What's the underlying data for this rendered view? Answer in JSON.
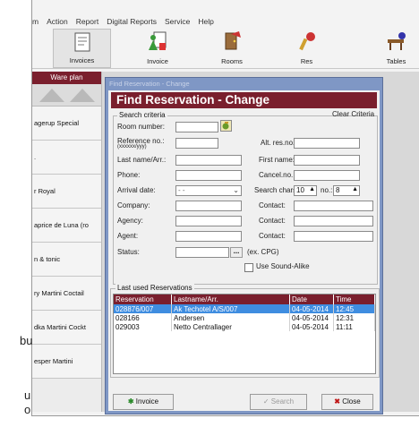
{
  "menu": [
    "m",
    "Action",
    "Report",
    "Digital Reports",
    "Service",
    "Help"
  ],
  "toolbar": {
    "invoices": "Invoices",
    "invoice": "Invoice",
    "rooms": "Rooms",
    "res": "Res",
    "tables": "Tables"
  },
  "left_panel": {
    "header": "Ware plan",
    "items": [
      "agerup Special",
      ".",
      "r Royal",
      "aprice de Luna (ro",
      "n & tonic",
      "ry Martini Coctail",
      "dka Martini Cockt",
      "esper Martini"
    ]
  },
  "outside_text": {
    "a": "bu",
    "b": "u",
    "c": "o"
  },
  "dialog": {
    "window_title": "Find Reservation - Change",
    "title": "Find Reservation - Change",
    "search_criteria_label": "Search criteria",
    "clear_criteria": "Clear Criteria",
    "labels": {
      "room_number": "Room number:",
      "reference_no": "Reference no.:",
      "reference_fmt": "(xxxxxx/yyy)",
      "alt_res_no": "Alt. res.no.:",
      "last_name": "Last name/Arr.:",
      "first_name": "First name:",
      "phone": "Phone:",
      "cancel_no": "Cancel.no.:",
      "arrival_date": "Arrival date:",
      "search_chars": "Search chars:",
      "no": "no.:",
      "company": "Company:",
      "contact1": "Contact:",
      "agency": "Agency:",
      "contact2": "Contact:",
      "agent": "Agent:",
      "contact3": "Contact:",
      "status": "Status:",
      "status_hint": "(ex. CPG)",
      "soundalike": "Use Sound-Alike"
    },
    "values": {
      "arrival_date": " -  - ",
      "search_chars": "10",
      "no": "8",
      "status_button": "..."
    },
    "last_used_label": "Last used Reservations",
    "table": {
      "columns": [
        "Reservation",
        "Lastname/Arr.",
        "Date",
        "Time"
      ],
      "rows": [
        [
          "028876/007",
          "Ak Techotel A/S/007",
          "04-05-2014",
          "12:45"
        ],
        [
          "028166",
          "Andersen",
          "04-05-2014",
          "12:31"
        ],
        [
          "029003",
          "Netto Centrallager",
          "04-05-2014",
          "11:11"
        ]
      ]
    },
    "buttons": {
      "invoice": "Invoice",
      "search": "Search",
      "close": "Close"
    }
  }
}
